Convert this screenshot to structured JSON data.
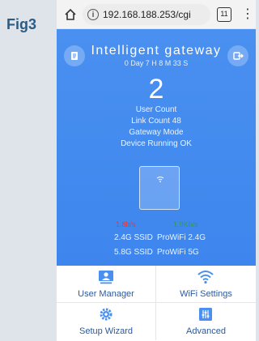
{
  "figure_label": "Fig3",
  "browser": {
    "url": "192.168.188.253/cgi",
    "tab_count": "11"
  },
  "header": {
    "title": "Intelligent gateway",
    "uptime": "0 Day 7 H 8 M 33 S"
  },
  "status": {
    "user_count_value": "2",
    "user_count_label": "User Count",
    "link_count": "Link Count 48",
    "mode": "Gateway Mode",
    "device_status": "Device Running OK"
  },
  "traffic": {
    "upload_rate": "1.8b/s",
    "download_rate": "1.9Kb/s",
    "upload_color": "#e53935",
    "download_color": "#2e9e4a"
  },
  "ssids": [
    {
      "label": "2.4G SSID",
      "value": "ProWiFi 2.4G"
    },
    {
      "label": "5.8G SSID",
      "value": "ProWiFi 5G"
    }
  ],
  "menu": {
    "user_manager": "User Manager",
    "wifi_settings": "WiFi Settings",
    "setup_wizard": "Setup Wizard",
    "advanced": "Advanced"
  },
  "colors": {
    "accent": "#4a90f0",
    "menu_text": "#2b5a9c"
  }
}
